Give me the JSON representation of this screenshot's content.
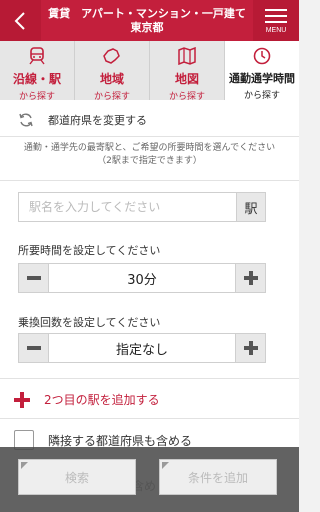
{
  "header": {
    "title_line1": "賃貸　アパート・マンション・一戸建て",
    "title_line2": "東京都",
    "menu_label": "MENU"
  },
  "tabs": [
    {
      "title": "沿線・駅",
      "sub": "から探す",
      "icon": "train-icon",
      "active": false
    },
    {
      "title": "地域",
      "sub": "から探す",
      "icon": "region-map-icon",
      "active": false
    },
    {
      "title": "地図",
      "sub": "から探す",
      "icon": "map-icon",
      "active": false
    },
    {
      "title": "通勤通学時間",
      "sub": "から探す",
      "icon": "clock-icon",
      "active": true
    }
  ],
  "prefecture": {
    "label": "都道府県を変更する",
    "icon": "refresh-icon"
  },
  "description": {
    "line1": "通勤・通学先の最寄駅と、ご希望の所要時間を選んでください",
    "line2": "（2駅まで指定できます）"
  },
  "station": {
    "placeholder": "駅名を入力してください",
    "button": "駅"
  },
  "travel_time": {
    "label": "所要時間を設定してください",
    "value": "30分"
  },
  "transfers": {
    "label": "乗換回数を設定してください",
    "value": "指定なし"
  },
  "add_station": {
    "label": "2つ目の駅を追加する"
  },
  "neighbor": {
    "label": "隣接する都道府県も含める",
    "ghost": "含め"
  },
  "footer": {
    "search": "検索",
    "add_condition": "条件を追加"
  },
  "colors": {
    "brand": "#c31f3c",
    "tab_inactive": "#e6e6e6"
  }
}
